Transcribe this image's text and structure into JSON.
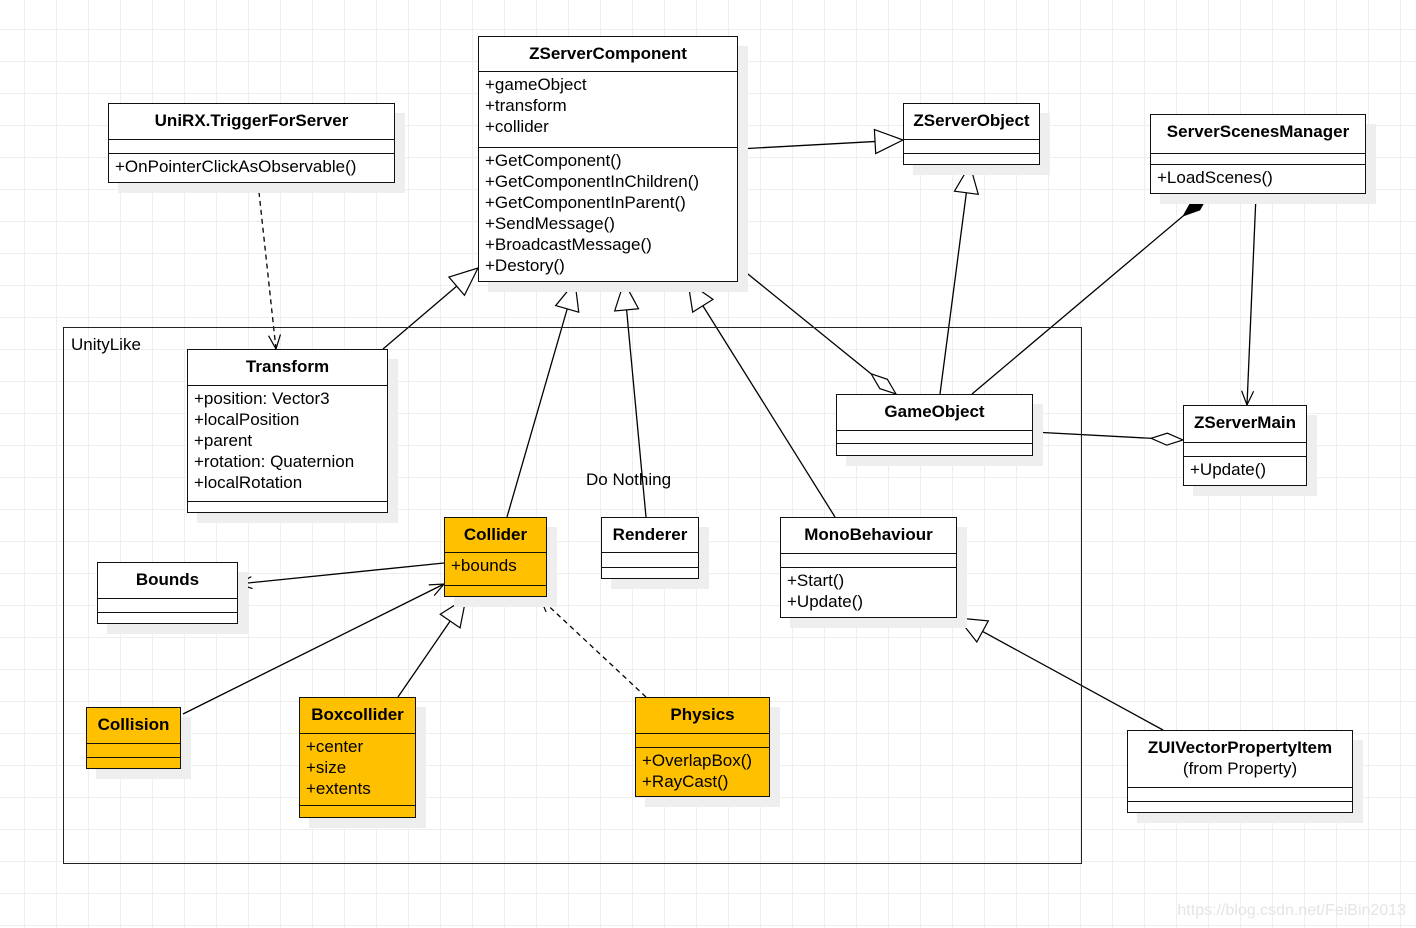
{
  "package": {
    "label": "UnityLike"
  },
  "note": "Do Nothing",
  "watermark": "https://blog.csdn.net/FeiBin2013",
  "colors": {
    "highlight": "#FFC000",
    "default": "#FFFFFF",
    "line": "#000000"
  },
  "classes": [
    {
      "id": "zservercomponent",
      "name": "ZServerComponent",
      "attributes": [
        "+gameObject",
        "+transform",
        "+collider"
      ],
      "methods": [
        "+GetComponent()",
        "+GetComponentInChildren()",
        "+GetComponentInParent()",
        "+SendMessage()",
        "+BroadcastMessage()",
        "+Destory()"
      ],
      "highlight": false
    },
    {
      "id": "unirx",
      "name": "UniRX.TriggerForServer",
      "attributes": [],
      "methods": [
        "+OnPointerClickAsObservable()"
      ],
      "highlight": false
    },
    {
      "id": "zserverobject",
      "name": "ZServerObject",
      "attributes": [],
      "methods": [],
      "highlight": false
    },
    {
      "id": "serverscenesmanager",
      "name": "ServerScenesManager",
      "attributes": [],
      "methods": [
        "+LoadScenes()"
      ],
      "highlight": false
    },
    {
      "id": "transform",
      "name": "Transform",
      "attributes": [
        "+position: Vector3",
        "+localPosition",
        "+parent",
        "+rotation: Quaternion",
        "+localRotation"
      ],
      "methods": [],
      "highlight": false
    },
    {
      "id": "gameobject",
      "name": "GameObject",
      "attributes": [],
      "methods": [],
      "highlight": false
    },
    {
      "id": "zservermain",
      "name": "ZServerMain",
      "attributes": [],
      "methods": [
        "+Update()"
      ],
      "highlight": false
    },
    {
      "id": "collider",
      "name": "Collider",
      "attributes": [
        "+bounds"
      ],
      "methods": [],
      "highlight": true
    },
    {
      "id": "renderer",
      "name": "Renderer",
      "attributes": [],
      "methods": [],
      "highlight": false
    },
    {
      "id": "monobehaviour",
      "name": "MonoBehaviour",
      "attributes": [],
      "methods": [
        "+Start()",
        "+Update()"
      ],
      "highlight": false
    },
    {
      "id": "bounds",
      "name": "Bounds",
      "attributes": [],
      "methods": [],
      "highlight": false
    },
    {
      "id": "collision",
      "name": "Collision",
      "attributes": [],
      "methods": [],
      "highlight": true
    },
    {
      "id": "boxcollider",
      "name": "Boxcollider",
      "attributes": [
        "+center",
        "+size",
        "+extents"
      ],
      "methods": [],
      "highlight": true
    },
    {
      "id": "physics",
      "name": "Physics",
      "attributes": [],
      "methods": [
        "+OverlapBox()",
        "+RayCast()"
      ],
      "highlight": true
    },
    {
      "id": "zuivector",
      "name": "ZUIVectorPropertyItem",
      "subtitle": "(from Property)",
      "attributes": [],
      "methods": [],
      "highlight": false
    }
  ],
  "relations": [
    {
      "from": "unirx",
      "to": "transform",
      "type": "dependency"
    },
    {
      "from": "transform",
      "to": "zservercomponent",
      "type": "generalization"
    },
    {
      "from": "collider",
      "to": "zservercomponent",
      "type": "generalization"
    },
    {
      "from": "renderer",
      "to": "zservercomponent",
      "type": "generalization"
    },
    {
      "from": "monobehaviour",
      "to": "zservercomponent",
      "type": "generalization"
    },
    {
      "from": "zservercomponent",
      "to": "zserverobject",
      "type": "generalization"
    },
    {
      "from": "gameobject",
      "to": "zserverobject",
      "type": "generalization"
    },
    {
      "from": "zservercomponent",
      "to": "gameobject",
      "type": "aggregation"
    },
    {
      "from": "gameobject",
      "to": "serverscenesmanager",
      "type": "composition"
    },
    {
      "from": "serverscenesmanager",
      "to": "zservermain",
      "type": "association"
    },
    {
      "from": "gameobject",
      "to": "zservermain",
      "type": "aggregation"
    },
    {
      "from": "collider",
      "to": "bounds",
      "type": "association"
    },
    {
      "from": "collision",
      "to": "collider",
      "type": "association"
    },
    {
      "from": "boxcollider",
      "to": "collider",
      "type": "generalization"
    },
    {
      "from": "physics",
      "to": "collider",
      "type": "dependency"
    },
    {
      "from": "zuivector",
      "to": "monobehaviour",
      "type": "generalization"
    }
  ]
}
